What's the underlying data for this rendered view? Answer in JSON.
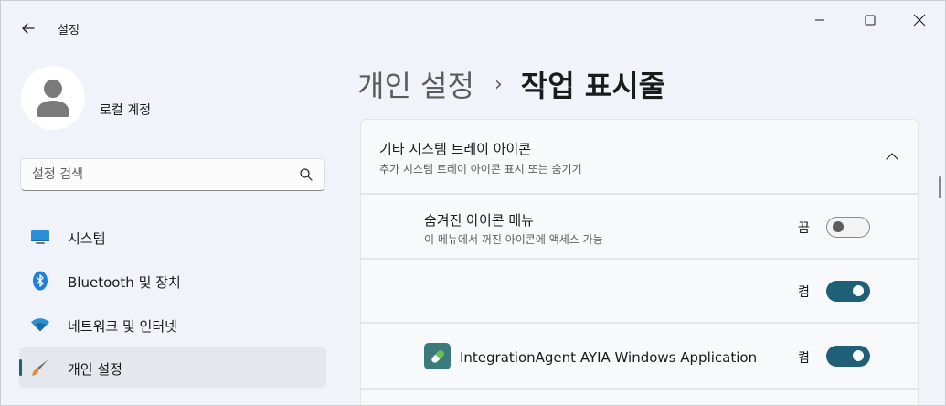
{
  "titlebar": {
    "app_title": "설정",
    "back_icon": "arrow-left-icon",
    "minimize_icon": "minimize-icon",
    "maximize_icon": "maximize-icon",
    "close_icon": "close-icon"
  },
  "account": {
    "name": "로컬 계정",
    "avatar_icon": "person-icon"
  },
  "search": {
    "placeholder": "설정 검색",
    "icon": "search-icon"
  },
  "sidebar": {
    "items": [
      {
        "label": "시스템",
        "icon": "monitor-icon",
        "active": false
      },
      {
        "label": "Bluetooth 및 장치",
        "icon": "bluetooth-icon",
        "active": false
      },
      {
        "label": "네트워크 및 인터넷",
        "icon": "wifi-icon",
        "active": false
      },
      {
        "label": "개인 설정",
        "icon": "brush-icon",
        "active": true
      }
    ]
  },
  "breadcrumb": {
    "parent": "개인 설정",
    "separator": "›",
    "current": "작업 표시줄"
  },
  "section": {
    "title": "기타 시스템 트레이 아이콘",
    "subtitle": "추가 시스템 트레이 아이콘 표시 또는 숨기기",
    "chevron_icon": "chevron-up-icon"
  },
  "rows": [
    {
      "title": "숨겨진 아이콘 메뉴",
      "subtitle": "이 메뉴에서 꺼진 아이콘에 액세스 가능",
      "state_label": "끔",
      "on": false
    },
    {
      "title": "",
      "state_label": "켬",
      "on": true
    },
    {
      "app_name": "IntegrationAgent AYIA Windows Application",
      "app_icon": "pill-icon",
      "state_label": "켬",
      "on": true
    }
  ],
  "colors": {
    "accent": "#1f5f78",
    "background": "#f0f3f9",
    "card": "#f8f9fb"
  }
}
